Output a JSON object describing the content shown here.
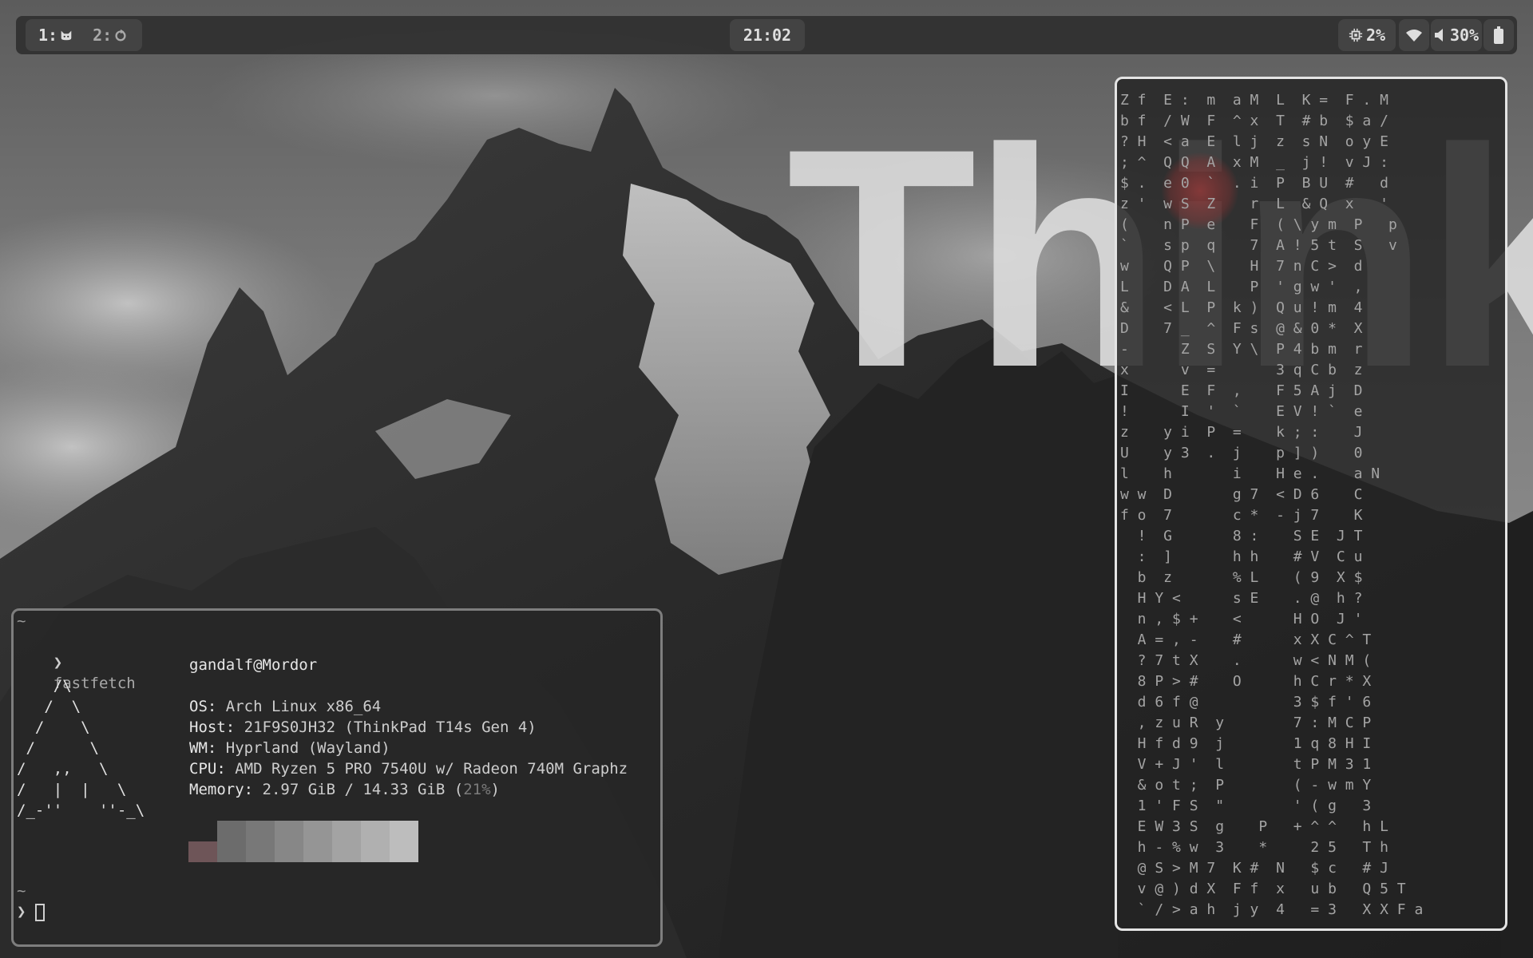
{
  "topbar": {
    "workspaces": [
      {
        "label": "1:",
        "icon": "cat-icon",
        "active": true
      },
      {
        "label": "2:",
        "icon": "refresh-icon",
        "active": false
      }
    ],
    "clock": "21:02",
    "cpu": {
      "icon": "cpu-chip-icon",
      "value": "2%"
    },
    "network": {
      "icon": "wifi-icon"
    },
    "volume": {
      "icon": "speaker-icon",
      "value": "30%"
    },
    "battery": {
      "icon": "battery-icon"
    }
  },
  "wallpaper": {
    "text": "Think"
  },
  "terminal": {
    "prompt_dir_1": "~",
    "prompt_symbol": "❯",
    "command": "fastfetch",
    "user_host": "gandalf@Mordor",
    "ascii_logo": "    /\\\n   /  \\\n  /    \\\n /      \\\n/   ,,   \\\n/   |  |   \\\n/_-''    ''-_\\",
    "info": [
      {
        "key": "OS:",
        "value": "Arch Linux x86_64"
      },
      {
        "key": "Host:",
        "value": "21F9S0JH32 (ThinkPad T14s Gen 4)"
      },
      {
        "key": "WM:",
        "value": "Hyprland (Wayland)"
      },
      {
        "key": "CPU:",
        "value": "AMD Ryzen 5 PRO 7540U w/ Radeon 740M Graphz"
      },
      {
        "key": "Memory:",
        "value": "2.97 GiB / 14.33 GiB (",
        "highlight": "21%",
        "suffix": ")"
      }
    ],
    "palette": [
      "#6e5558",
      "#6c6c6c",
      "#787878",
      "#878787",
      "#959595",
      "#a3a3a3",
      "#b0b0b0",
      "#bdbdbd"
    ],
    "prompt_dir_2": "~"
  },
  "matrix": {
    "rows": [
      "Z f  E :  m  a M  L  K =  F . M",
      "b f  / W  F  ^ x  T  # b  $ a /",
      "? H  < a  E  l j  z  s N  o y E",
      "; ^  Q Q  A  x M  _  j !  v J :",
      "$ .  e 0  `  . i  P  B U  #   d",
      "z '  w S  Z    r  L  & Q  x   '",
      "(    n P  e    F  ( \\ y m  P   p",
      "`    s p  q    7  A ! 5 t  S   v",
      "w    Q P  \\    H  7 n C >  d",
      "L    D A  L    P  ' g w '  ,",
      "&    < L  P  k )  Q u ! m  4",
      "D    7 _  ^  F s  @ & 0 *  X",
      "-      Z  S  Y \\  P 4 b m  r",
      "x      v  =       3 q C b  z",
      "I      E  F  ,    F 5 A j  D",
      "!      I  '  `    E V ! `  e",
      "z    y i  P  =    k ; :    J",
      "U    y 3  .  j    p ] )    0",
      "l    h       i    H e .    a N",
      "w w  D       g 7  < D 6    C",
      "f o  7       c *  - j 7    K",
      "  !  G       8 :    S E  J T",
      "  :  ]       h h    # V  C u",
      "  b  z       % L    ( 9  X $",
      "  H Y <      s E    . @  h ?",
      "  n , $ +    <      H O  J '",
      "  A = , -    #      x X C ^ T",
      "  ? 7 t X    .      w < N M (",
      "  8 P > #    O      h C r * X",
      "  d 6 f @           3 $ f ' 6",
      "  , z u R  y        7 : M C P",
      "  H f d 9  j        1 q 8 H I",
      "  V + J '  l        t P M 3 1",
      "  & o t ;  P        ( - w m Y",
      "  1 ' F S  \"        ' ( g   3",
      "  E W 3 S  g    P   + ^ ^   h L",
      "  h - % w  3    *     2 5   T h",
      "  @ S > M 7  K #  N   $ c   # J",
      "  v @ ) d X  F f  x   u b   Q 5 T",
      "  ` / > a h  j y  4   = 3   X X F a"
    ]
  }
}
